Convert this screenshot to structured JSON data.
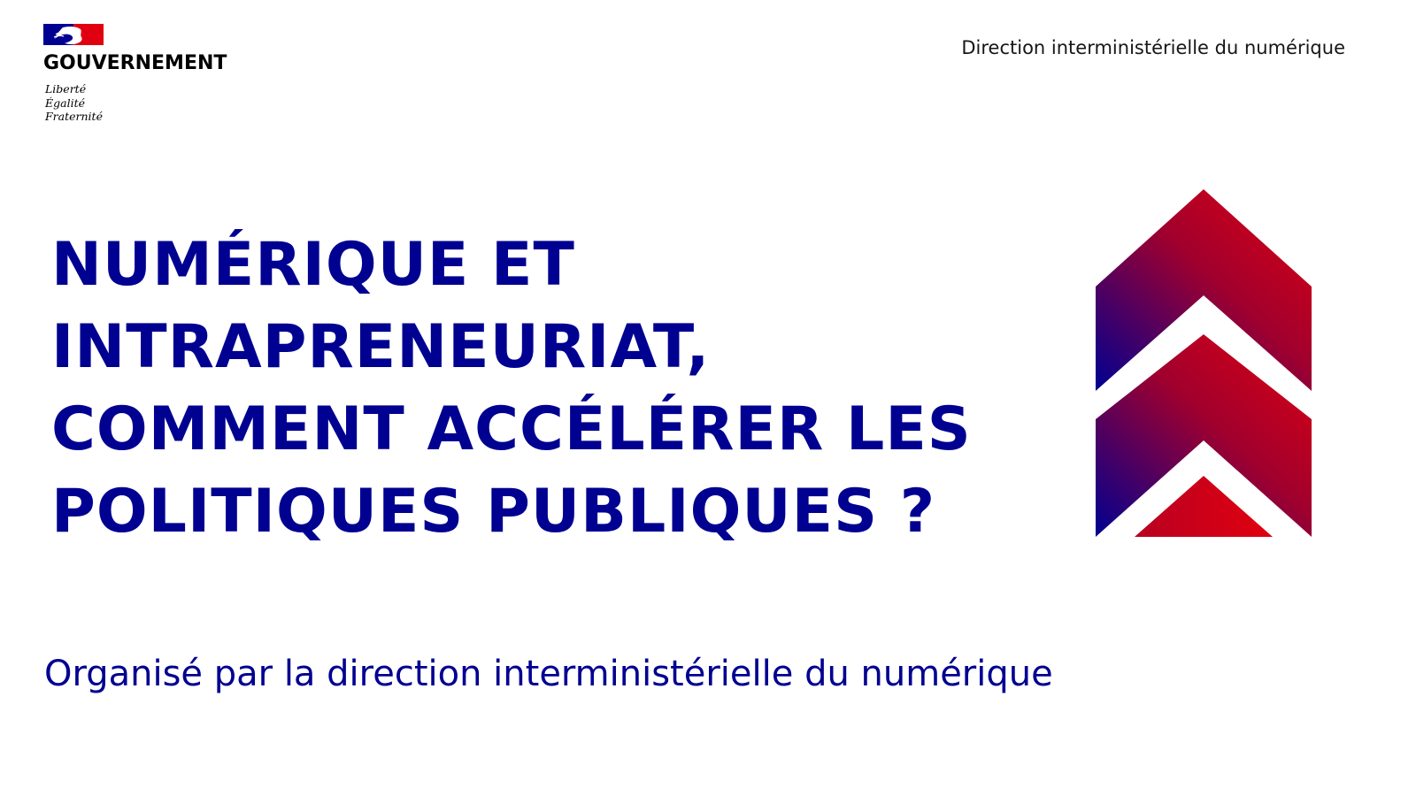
{
  "header": {
    "brand": "GOUVERNEMENT",
    "motto": [
      "Liberté",
      "Égalité",
      "Fraternité"
    ],
    "organization": "Direction interministérielle du numérique"
  },
  "main": {
    "title_lines": [
      "NUMÉRIQUE ET",
      "INTRAPRENEURIAT,",
      "COMMENT ACCÉLÉRER LES",
      "POLITIQUES PUBLIQUES ?"
    ],
    "subtitle": "Organisé par la direction interministérielle du numérique"
  },
  "colors": {
    "primary_blue": "#000091",
    "marianne_red": "#e1000f",
    "gradient_start": "#000091",
    "gradient_end": "#e1000f"
  },
  "icons": {
    "logo": "marianne-logo-icon",
    "illustration": "double-chevron-up-icon"
  }
}
